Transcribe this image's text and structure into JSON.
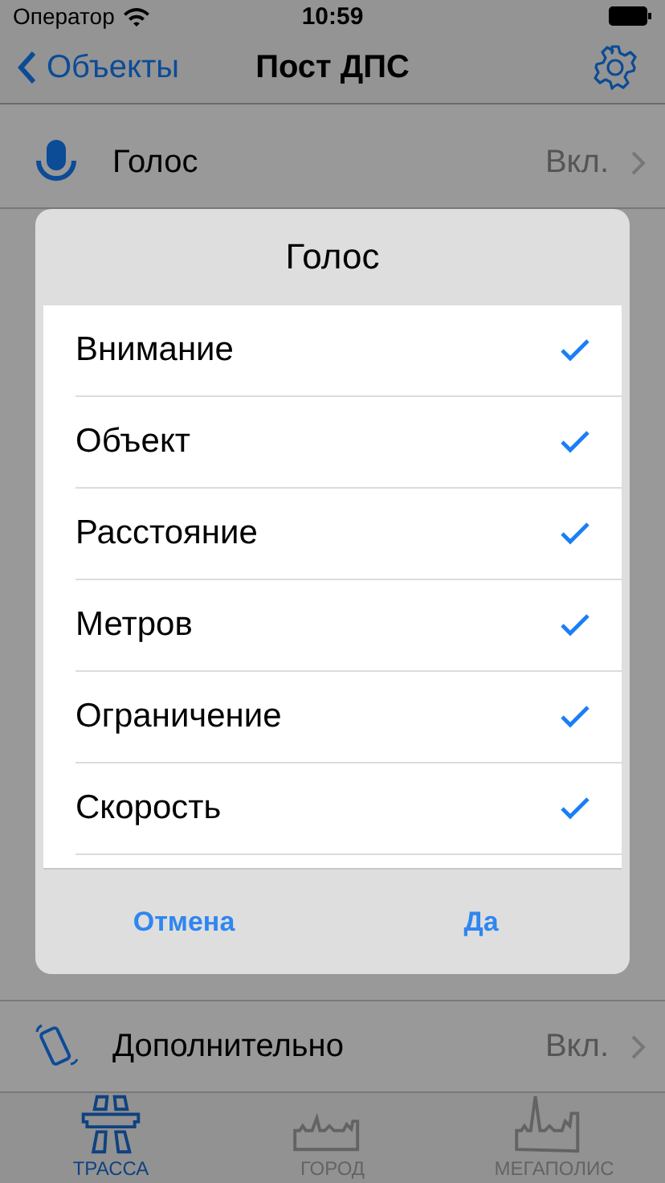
{
  "status_bar": {
    "carrier": "Оператор",
    "time": "10:59"
  },
  "nav": {
    "back": "Объекты",
    "title": "Пост ДПС"
  },
  "settings": [
    {
      "kind": "mic",
      "label": "Голос",
      "value": "Вкл."
    },
    {
      "kind": "phone",
      "label": "Дополнительно",
      "value": "Вкл."
    }
  ],
  "dialog": {
    "title": "Голос",
    "options": [
      {
        "label": "Внимание",
        "checked": true
      },
      {
        "label": "Объект",
        "checked": true
      },
      {
        "label": "Расстояние",
        "checked": true
      },
      {
        "label": "Метров",
        "checked": true
      },
      {
        "label": "Ограничение",
        "checked": true
      },
      {
        "label": "Скорость",
        "checked": true
      }
    ],
    "buttons": [
      "Отмена",
      "Да"
    ]
  },
  "tabs": [
    {
      "kind": "highway",
      "label": "ТРАССА",
      "selected": true
    },
    {
      "kind": "city",
      "label": "ГОРОД",
      "selected": false
    },
    {
      "kind": "metropolis",
      "label": "МЕГАПОЛИС",
      "selected": false
    }
  ]
}
